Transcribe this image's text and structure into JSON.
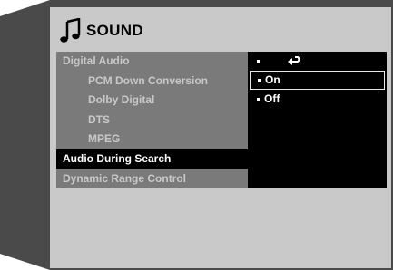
{
  "header": {
    "title": "SOUND",
    "icon": "music-note-icon"
  },
  "menu": {
    "items": [
      {
        "label": "Digital Audio",
        "level": 0
      },
      {
        "label": "PCM Down Conversion",
        "level": 1
      },
      {
        "label": "Dolby Digital",
        "level": 1
      },
      {
        "label": "DTS",
        "level": 1
      },
      {
        "label": "MPEG",
        "level": 1
      },
      {
        "label": "Audio  During Search",
        "level": 0,
        "selected": true
      },
      {
        "label": "Dynamic Range Control",
        "level": 0
      }
    ]
  },
  "options": {
    "return_icon": "return-arrow-icon",
    "items": [
      {
        "label": "On",
        "highlighted": true
      },
      {
        "label": "Off",
        "highlighted": false
      }
    ]
  },
  "colors": {
    "frame": "#4a4a4a",
    "screen": "#c9c9c9",
    "menu_bg": "#7a7a7a",
    "menu_text": "#c8c8c8",
    "selected_bg": "#000000",
    "selected_text": "#ffffff"
  }
}
